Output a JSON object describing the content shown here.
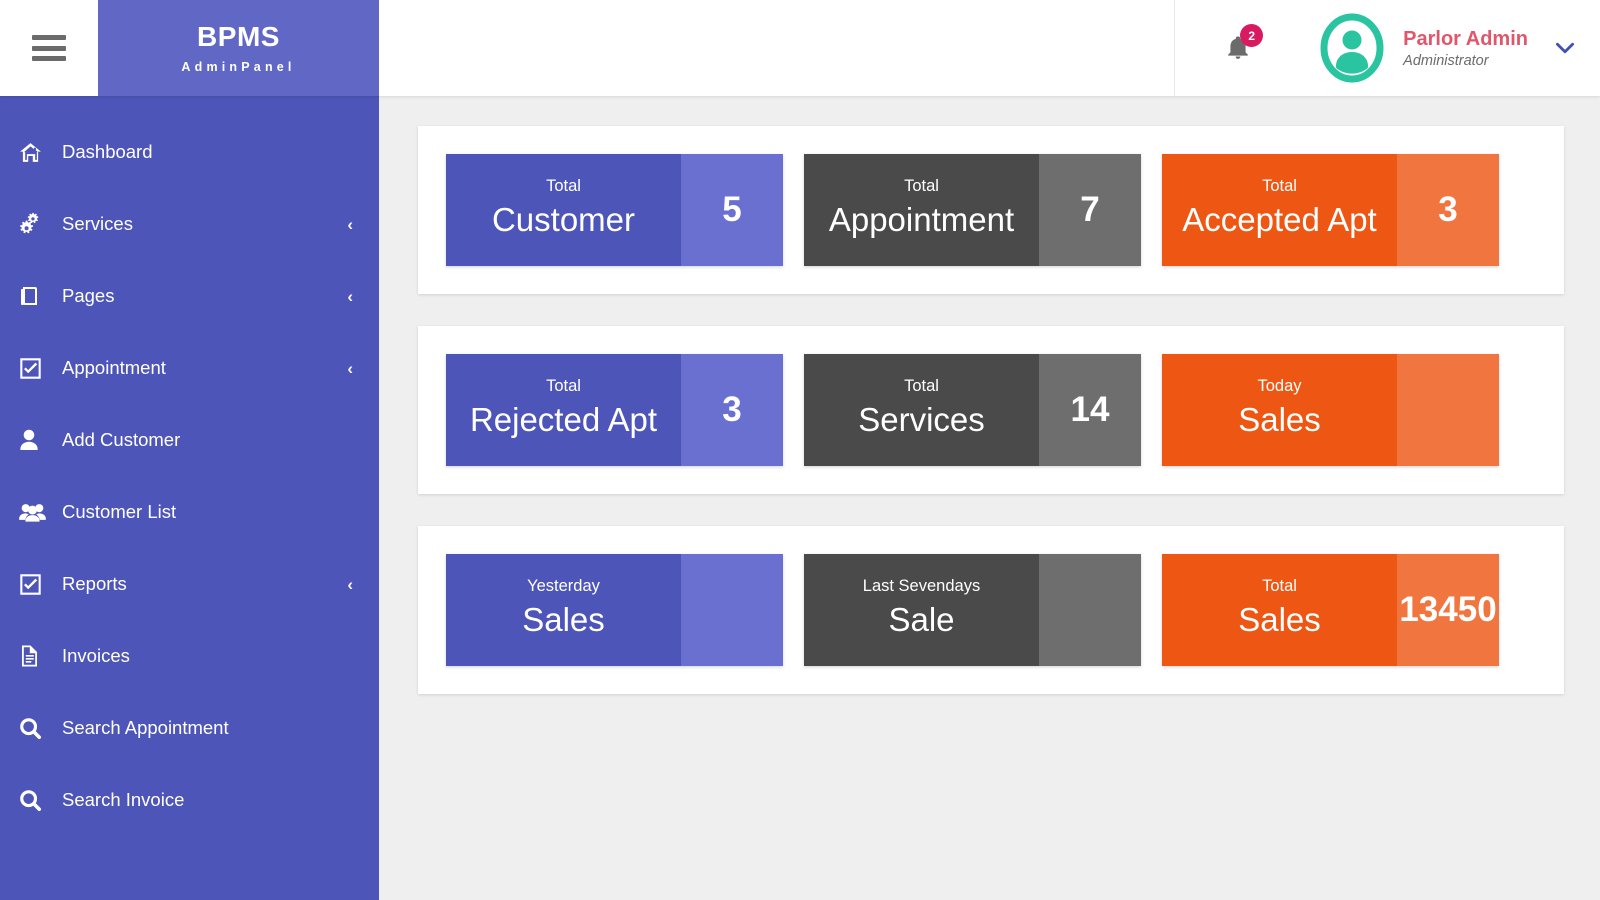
{
  "topbar": {
    "menu_icon": "hamburger-icon",
    "brand_title": "BPMS",
    "brand_subtitle": "AdminPanel",
    "notification_icon": "bell-icon",
    "notification_count": "2",
    "avatar_icon": "user-avatar-icon",
    "user_name": "Parlor Admin",
    "user_role": "Administrator",
    "dropdown_icon": "chevron-down-icon"
  },
  "sidebar": {
    "items": [
      {
        "label": "Dashboard",
        "icon": "home-icon",
        "caret": ""
      },
      {
        "label": "Services",
        "icon": "gears-icon",
        "caret": "‹"
      },
      {
        "label": "Pages",
        "icon": "book-icon",
        "caret": "‹"
      },
      {
        "label": "Appointment",
        "icon": "check-square-icon",
        "caret": "‹"
      },
      {
        "label": "Add Customer",
        "icon": "user-icon",
        "caret": ""
      },
      {
        "label": "Customer List",
        "icon": "users-icon",
        "caret": ""
      },
      {
        "label": "Reports",
        "icon": "check-square-icon",
        "caret": "‹"
      },
      {
        "label": "Invoices",
        "icon": "file-text-icon",
        "caret": ""
      },
      {
        "label": "Search Appointment",
        "icon": "search-icon",
        "caret": ""
      },
      {
        "label": "Search Invoice",
        "icon": "search-icon",
        "caret": ""
      }
    ]
  },
  "colors": {
    "sidebar": "#4e55b8",
    "brand_header": "#6067c4",
    "purple_card_dark": "#4e55b8",
    "purple_card_light": "#6a70cf",
    "grey_card_dark": "#4a4a4a",
    "grey_card_light": "#6e6e6e",
    "orange_card_dark": "#ee5713",
    "orange_card_light": "#f1753e",
    "badge": "#d81b60",
    "avatar": "#2bc4a0",
    "user_name": "#e0576b",
    "page_background": "#efefef"
  },
  "main": {
    "rows": [
      {
        "cards": [
          {
            "period": "Total",
            "title": "Customer",
            "value": "5",
            "theme": "purple"
          },
          {
            "period": "Total",
            "title": "Appointment",
            "value": "7",
            "theme": "grey"
          },
          {
            "period": "Total",
            "title": "Accepted Apt",
            "value": "3",
            "theme": "orange"
          }
        ]
      },
      {
        "cards": [
          {
            "period": "Total",
            "title": "Rejected Apt",
            "value": "3",
            "theme": "purple"
          },
          {
            "period": "Total",
            "title": "Services",
            "value": "14",
            "theme": "grey"
          },
          {
            "period": "Today",
            "title": "Sales",
            "value": "",
            "theme": "orange"
          }
        ]
      },
      {
        "cards": [
          {
            "period": "Yesterday",
            "title": "Sales",
            "value": "",
            "theme": "purple"
          },
          {
            "period": "Last Sevendays",
            "title": "Sale",
            "value": "",
            "theme": "grey"
          },
          {
            "period": "Total",
            "title": "Sales",
            "value": "13450",
            "theme": "orange"
          }
        ]
      }
    ]
  }
}
